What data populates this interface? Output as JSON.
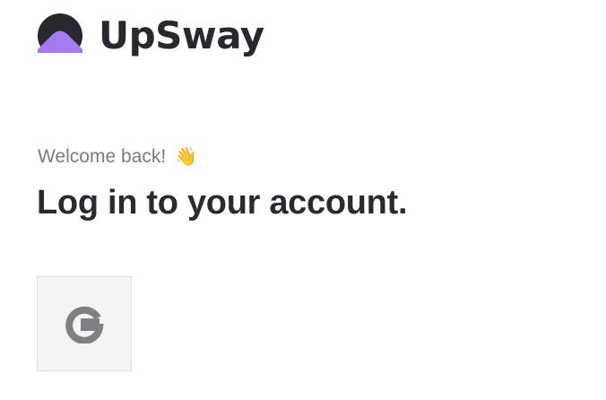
{
  "brand": {
    "name": "UpSway",
    "logo_icon": "upsway-logo-icon",
    "colors": {
      "dark": "#2a282f",
      "accent": "#a47cf0"
    }
  },
  "login": {
    "welcome_text": "Welcome back!",
    "welcome_emoji": "👋",
    "headline": "Log in to your account."
  },
  "social": {
    "google_icon": "google-g-icon",
    "google_icon_color": "#7f7f84"
  }
}
